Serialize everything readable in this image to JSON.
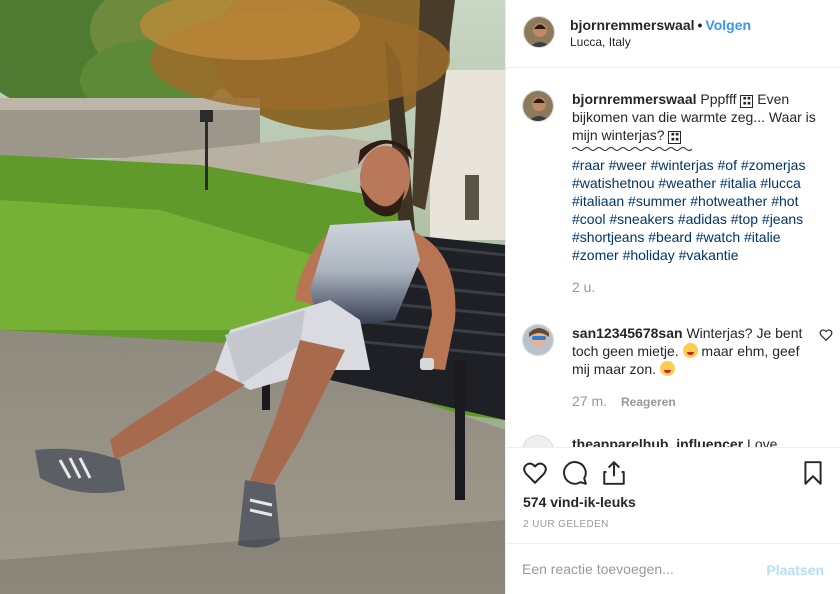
{
  "post": {
    "username": "bjornremmerswaal",
    "follow_label": "Volgen",
    "location": "Lucca, Italy"
  },
  "caption": {
    "username": "bjornremmerswaal",
    "text_1": "Pppfff",
    "text_2": "Even bijkomen van die warmte zeg... Waar is mijn winterjas?",
    "hashtags": "#raar #weer #winterjas #of #zomerjas #watishetnou #weather #italia #lucca #italiaan #summer #hotweather #hot #cool #sneakers #adidas #top #jeans #shortjeans #beard #watch #italie #zomer #holiday #vakantie",
    "time": "2 u."
  },
  "comments": [
    {
      "username": "san12345678san",
      "text_1": "Winterjas? Je bent toch geen mietje.",
      "text_2": "maar ehm, geef mij maar zon.",
      "time": "27 m.",
      "reply_label": "Reageren"
    },
    {
      "username": "theapparelhub_influencer",
      "text": "Love"
    }
  ],
  "stats": {
    "likes": "574 vind-ik-leuks",
    "ago": "2 UUR GELEDEN"
  },
  "add_comment": {
    "placeholder": "Een reactie toevoegen...",
    "post_label": "Plaatsen"
  },
  "icons": [
    "heart-icon",
    "comment-icon",
    "share-icon",
    "bookmark-icon",
    "small-heart-icon"
  ],
  "colors": {
    "link": "#3897f0",
    "hashtag": "#003569",
    "muted": "#999999",
    "post_disabled": "#b2dffc"
  }
}
